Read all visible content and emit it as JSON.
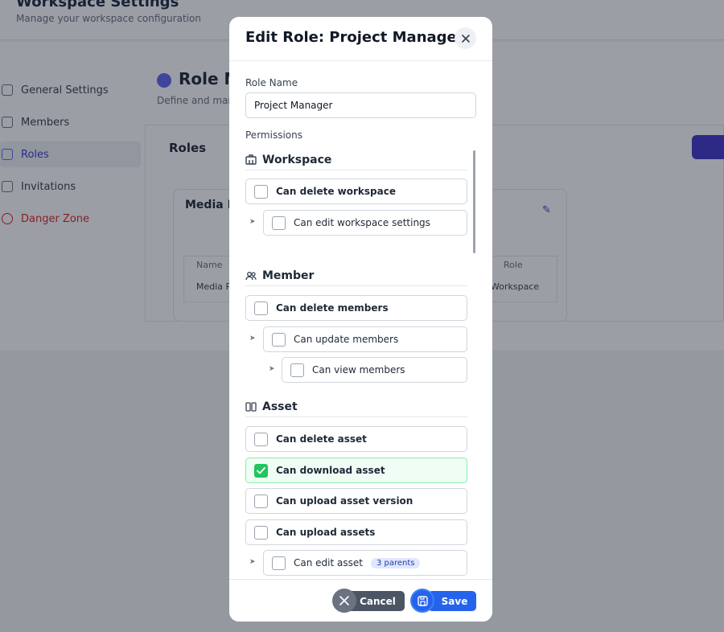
{
  "background": {
    "title": "Workspace Settings",
    "subtitle": "Manage your workspace configuration",
    "sidebar": [
      {
        "label": "General Settings"
      },
      {
        "label": "Members"
      },
      {
        "label": "Roles"
      },
      {
        "label": "Invitations"
      },
      {
        "label": "Danger Zone"
      }
    ],
    "role_title": "Role M",
    "role_subtitle": "Define and man",
    "roles_label": "Roles",
    "card_title": "Media Pr",
    "table_header_name": "Name",
    "table_header_role": "Role",
    "table_cell_1": "Media Pr",
    "table_cell_2": "Workspace"
  },
  "modal": {
    "title": "Edit Role: Project Manager",
    "role_name_label": "Role Name",
    "role_name_value": "Project Manager",
    "permissions_label": "Permissions",
    "groups": [
      {
        "title": "Workspace",
        "icon": "building-icon",
        "items": [
          {
            "label": "Can delete workspace",
            "checked": false,
            "level": 0
          },
          {
            "label": "Can edit workspace settings",
            "checked": false,
            "level": 1
          }
        ]
      },
      {
        "title": "Member",
        "icon": "users-icon",
        "items": [
          {
            "label": "Can delete members",
            "checked": false,
            "level": 0
          },
          {
            "label": "Can update members",
            "checked": false,
            "level": 1
          },
          {
            "label": "Can view members",
            "checked": false,
            "level": 2
          }
        ]
      },
      {
        "title": "Asset",
        "icon": "asset-icon",
        "items": [
          {
            "label": "Can delete asset",
            "checked": false,
            "level": 0
          },
          {
            "label": "Can download asset",
            "checked": true,
            "level": 0
          },
          {
            "label": "Can upload asset version",
            "checked": false,
            "level": 0
          },
          {
            "label": "Can upload assets",
            "checked": false,
            "level": 0
          },
          {
            "label": "Can edit asset",
            "checked": false,
            "level": 1,
            "badge": "3 parents"
          }
        ]
      }
    ],
    "cancel_label": "Cancel",
    "save_label": "Save"
  },
  "colors": {
    "accent": "#2563eb",
    "checked": "#22c55e",
    "danger": "#dc2626"
  }
}
